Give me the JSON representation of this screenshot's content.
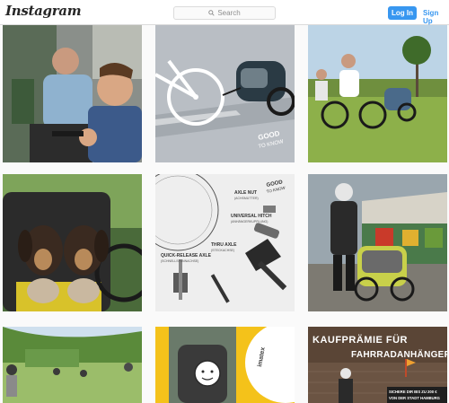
{
  "header": {
    "logo_text": "Instagram",
    "search_placeholder": "Search",
    "login_label": "Log In",
    "signup_label": "Sign Up"
  },
  "posts": [
    {
      "id": 1,
      "labels": []
    },
    {
      "id": 2,
      "labels": [
        "GOOD",
        "TO KNOW"
      ]
    },
    {
      "id": 3,
      "labels": []
    },
    {
      "id": 4,
      "labels": []
    },
    {
      "id": 5,
      "labels": [
        "AXLE NUT",
        "(ACHSMUTTER)",
        "UNIVERSAL HITCH",
        "(ANHÄNGERKUPPLUNG)",
        "QUICK-RELEASE AXLE",
        "(SCHNELLSPANNACHSE)",
        "THRU AXLE",
        "(STECKACHSE)",
        "GOOD",
        "TO KNOW"
      ]
    },
    {
      "id": 6,
      "labels": []
    },
    {
      "id": 7,
      "labels": []
    },
    {
      "id": 8,
      "labels": [
        "imatex"
      ]
    },
    {
      "id": 9,
      "labels": [
        "KAUFPRÄMIE FÜR",
        "FAHRRADANHÄNGER",
        "SICHERE DIR BIS ZU 200 €",
        "VON DER STADT HAMBURG"
      ]
    }
  ],
  "colors": {
    "accent": "#3897f0",
    "border": "#dbdbdb",
    "background": "#fafafa"
  }
}
